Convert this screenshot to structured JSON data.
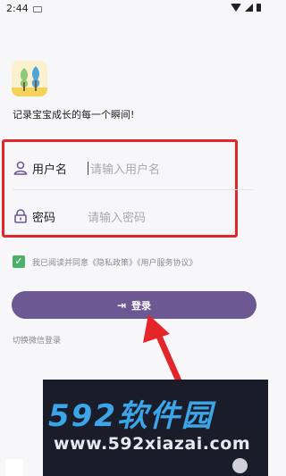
{
  "status_bar": {
    "time": "2:44"
  },
  "tagline": "记录宝宝成长的每一个瞬间!",
  "form": {
    "username_label": "用户名",
    "username_placeholder": "请输入用户名",
    "password_label": "密码",
    "password_placeholder": "请输入密码"
  },
  "agreement": {
    "checked": true,
    "text": "我已阅读并同意《隐私政策》《用户服务协议》"
  },
  "login_button": {
    "label": "登录"
  },
  "wechat_login": "切换微信登录",
  "watermark": {
    "brand": "592软件园",
    "site": "www.592xiazai.com"
  },
  "colors": {
    "accent": "#6c5893",
    "annotation": "#e4262b",
    "check": "#4caf6a"
  }
}
